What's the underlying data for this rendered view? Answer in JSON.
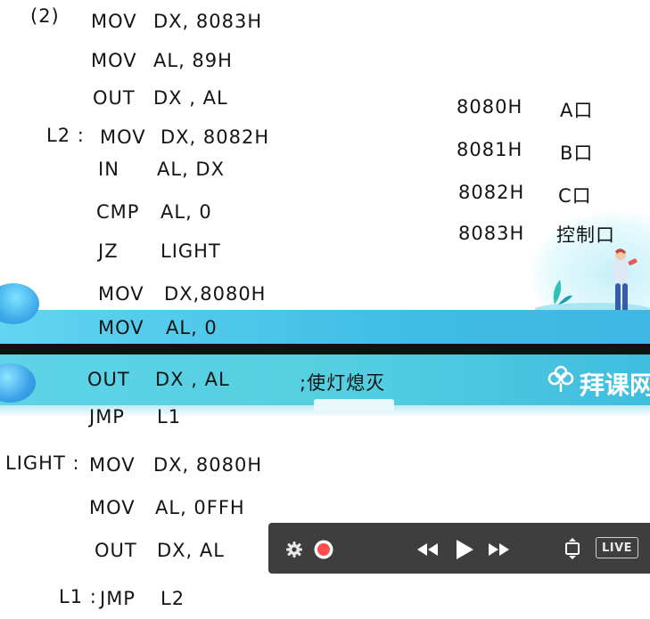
{
  "code": {
    "label_12": "(2)",
    "lines": [
      {
        "op": "MOV",
        "args": "DX, 8083H"
      },
      {
        "op": "MOV",
        "args": "AL, 89H"
      },
      {
        "op": "OUT",
        "args": "DX , AL"
      },
      {
        "label": "L2 :",
        "op": "MOV",
        "args": "DX, 8082H"
      },
      {
        "op": "IN",
        "args": "AL, DX"
      },
      {
        "op": "CMP",
        "args": "AL, 0"
      },
      {
        "op": "JZ",
        "args": "LIGHT"
      },
      {
        "op": "MOV",
        "args": "DX,8080H"
      },
      {
        "op": "MOV",
        "args": "AL, 0"
      },
      {
        "op": "OUT",
        "args": "DX , AL",
        "comment": ";使灯熄灭"
      },
      {
        "op": "JMP",
        "args": "L1"
      },
      {
        "label": "LIGHT :",
        "op": "MOV",
        "args": "DX, 8080H"
      },
      {
        "op": "MOV",
        "args": "AL, 0FFH"
      },
      {
        "op": "OUT",
        "args": "DX, AL"
      },
      {
        "label": "L1 :",
        "op": "JMP",
        "args": "L2"
      }
    ]
  },
  "ports": [
    {
      "addr": "8080H",
      "name": "A口"
    },
    {
      "addr": "8081H",
      "name": "B口"
    },
    {
      "addr": "8082H",
      "name": "C口"
    },
    {
      "addr": "8083H",
      "name": "控制口"
    }
  ],
  "banner": {
    "brand": "拜课网"
  },
  "player": {
    "settings_icon": "gear-icon",
    "record_icon": "record-icon",
    "rewind_icon": "rewind-icon",
    "play_icon": "play-icon",
    "forward_icon": "fast-forward-icon",
    "fit_icon": "fit-screen-icon",
    "live_label": "LIVE",
    "colors": {
      "bar": "#3e3e3e",
      "record": "#ff4d4d",
      "icon": "#e9e9e9"
    }
  }
}
